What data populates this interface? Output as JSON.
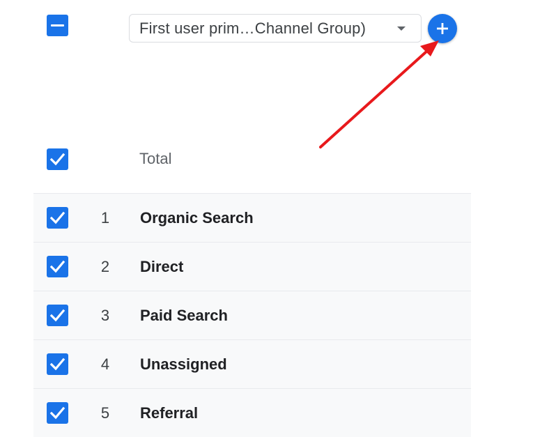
{
  "header": {
    "select_all_state": "indeterminate",
    "dimension_select": {
      "value": "First user prim…Channel Group)",
      "icon": "arrow-drop-down-icon"
    },
    "add_dimension_icon": "plus-icon"
  },
  "annotation": {
    "type": "arrow",
    "color": "#e8191c",
    "points_to": "add-dimension-button"
  },
  "table": {
    "total_label": "Total",
    "total_checked": true,
    "rows": [
      {
        "index": "1",
        "label": "Organic Search",
        "checked": true
      },
      {
        "index": "2",
        "label": "Direct",
        "checked": true
      },
      {
        "index": "3",
        "label": "Paid Search",
        "checked": true
      },
      {
        "index": "4",
        "label": "Unassigned",
        "checked": true
      },
      {
        "index": "5",
        "label": "Referral",
        "checked": true
      }
    ]
  },
  "colors": {
    "accent": "#1a73e8",
    "row_background": "#f8f9fa",
    "arrow": "#e8191c"
  }
}
